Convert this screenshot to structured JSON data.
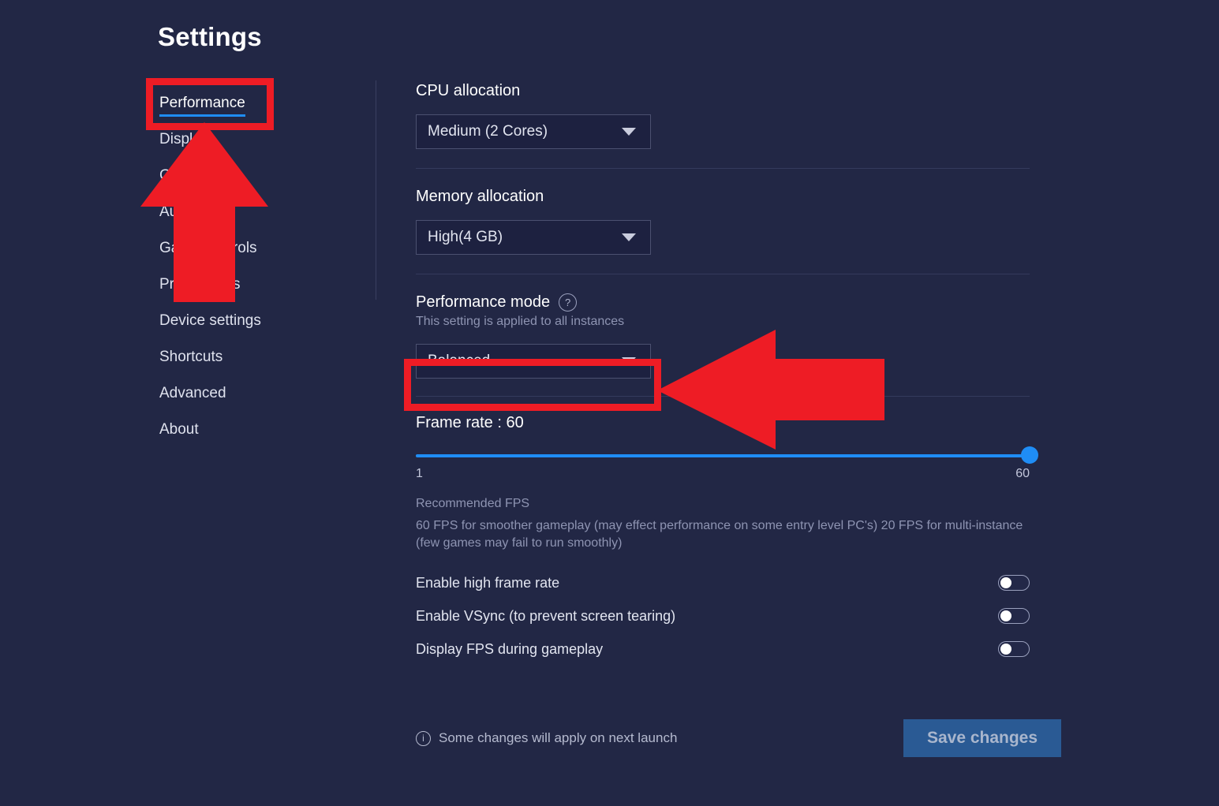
{
  "page": {
    "title": "Settings"
  },
  "sidebar": {
    "items": [
      {
        "label": "Performance",
        "active": true
      },
      {
        "label": "Display",
        "active": false
      },
      {
        "label": "Graphics",
        "active": false
      },
      {
        "label": "Audio",
        "active": false
      },
      {
        "label": "Game controls",
        "active": false
      },
      {
        "label": "Preferences",
        "active": false
      },
      {
        "label": "Device settings",
        "active": false
      },
      {
        "label": "Shortcuts",
        "active": false
      },
      {
        "label": "Advanced",
        "active": false
      },
      {
        "label": "About",
        "active": false
      }
    ]
  },
  "main": {
    "cpu": {
      "label": "CPU allocation",
      "value": "Medium (2 Cores)"
    },
    "memory": {
      "label": "Memory allocation",
      "value": "High(4 GB)"
    },
    "performance_mode": {
      "label": "Performance mode",
      "help_icon": "question-circle-icon",
      "note": "This setting is applied to all instances",
      "value": "Balanced"
    },
    "frame_rate": {
      "title": "Frame rate : 60",
      "value": 60,
      "min": 1,
      "max": 60,
      "min_label": "1",
      "max_label": "60",
      "recommended_title": "Recommended FPS",
      "recommended_text": "60 FPS for smoother gameplay (may effect performance on some entry level PC's) 20 FPS for multi-instance (few games may fail to run smoothly)"
    },
    "toggles": [
      {
        "label": "Enable high frame rate",
        "on": false
      },
      {
        "label": "Enable VSync (to prevent screen tearing)",
        "on": false
      },
      {
        "label": "Display FPS during gameplay",
        "on": false
      }
    ]
  },
  "footer": {
    "info_icon": "info-circle-icon",
    "note": "Some changes will apply on next launch",
    "save_label": "Save changes"
  },
  "annotations": {
    "color": "#ee1c25",
    "up_arrow_target": "Performance",
    "left_arrow_target": "Balanced"
  },
  "colors": {
    "background": "#222745",
    "accent_blue": "#1f8df5",
    "save_button": "#2a5a94",
    "annotation_red": "#ee1c25"
  }
}
